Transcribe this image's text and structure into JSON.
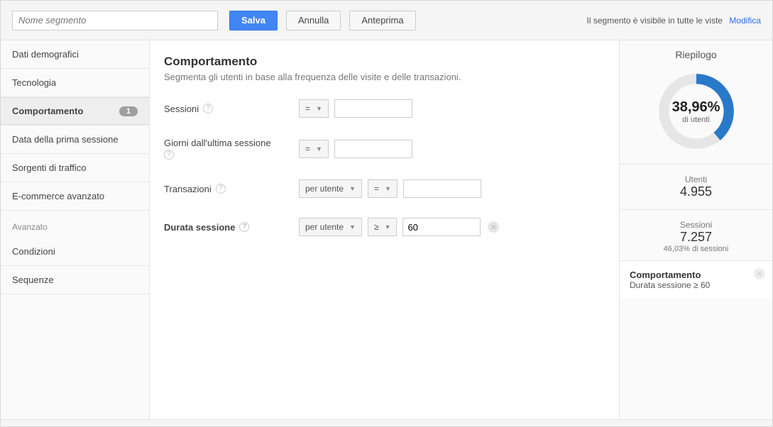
{
  "top": {
    "segment_name_placeholder": "Nome segmento",
    "save": "Salva",
    "cancel": "Annulla",
    "preview": "Anteprima",
    "visibility_note": "Il segmento è visibile in tutte le viste",
    "edit_link": "Modifica"
  },
  "sidebar": {
    "items": [
      {
        "label": "Dati demografici"
      },
      {
        "label": "Tecnologia"
      },
      {
        "label": "Comportamento",
        "active": true,
        "badge": "1"
      },
      {
        "label": "Data della prima sessione"
      },
      {
        "label": "Sorgenti di traffico"
      },
      {
        "label": "E-commerce avanzato"
      }
    ],
    "advanced_header": "Avanzato",
    "advanced_items": [
      {
        "label": "Condizioni"
      },
      {
        "label": "Sequenze"
      }
    ]
  },
  "main": {
    "title": "Comportamento",
    "description": "Segmenta gli utenti in base alla frequenza delle visite e delle transazioni.",
    "rows": {
      "sessions": {
        "label": "Sessioni",
        "op": "=",
        "value": ""
      },
      "days_since": {
        "label": "Giorni dall'ultima sessione",
        "op": "=",
        "value": ""
      },
      "transactions": {
        "label": "Transazioni",
        "scope": "per utente",
        "op": "=",
        "value": ""
      },
      "duration": {
        "label": "Durata sessione",
        "scope": "per utente",
        "op": "≥",
        "value": "60"
      }
    }
  },
  "summary": {
    "title": "Riepilogo",
    "percent": "38,96%",
    "percent_label": "di utenti",
    "users_label": "Utenti",
    "users_value": "4.955",
    "sessions_label": "Sessioni",
    "sessions_value": "7.257",
    "sessions_sub": "46,03% di sessioni",
    "filter_title": "Comportamento",
    "filter_line": "Durata sessione ≥ 60",
    "donut_color": "#2979c9",
    "donut_bg": "#e6e6e6",
    "donut_fraction": 0.3896
  }
}
